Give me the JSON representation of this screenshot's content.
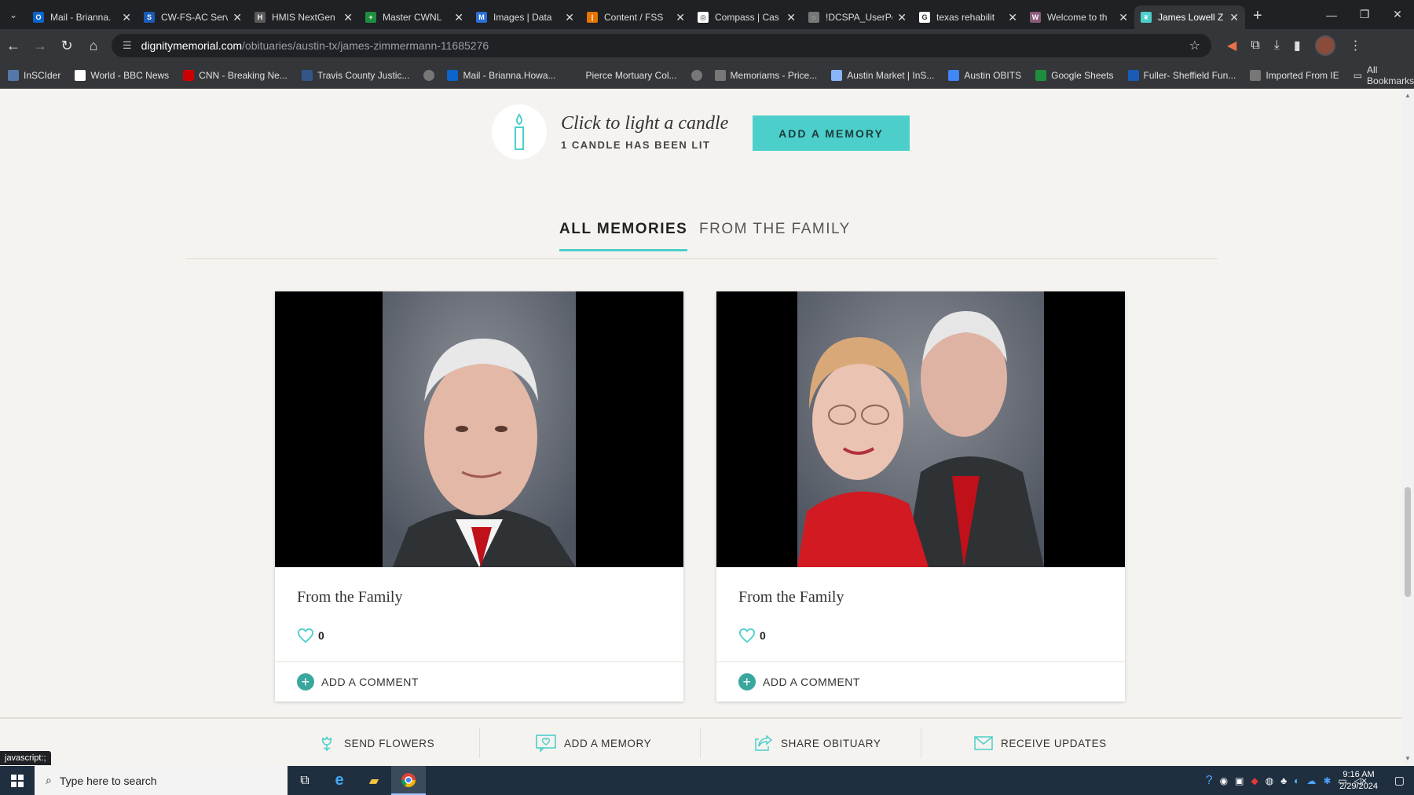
{
  "browser": {
    "tabs": [
      {
        "label": "Mail - Brianna.",
        "color": "#0a64c9",
        "glyph": "O"
      },
      {
        "label": "CW-FS-AC Serv",
        "color": "#1a5bb8",
        "glyph": "S"
      },
      {
        "label": "HMIS NextGen",
        "color": "#5a5a5a",
        "glyph": "H"
      },
      {
        "label": "Master CWNL",
        "color": "#1e8e3e",
        "glyph": "+"
      },
      {
        "label": "Images | Data",
        "color": "#2a6fd6",
        "glyph": "M"
      },
      {
        "label": "Content / FSS",
        "color": "#e37400",
        "glyph": "|"
      },
      {
        "label": "Compass | Cas",
        "color": "#ffffff",
        "glyph": "◎"
      },
      {
        "label": "!DCSPA_UserPo",
        "color": "#777777",
        "glyph": "◌"
      },
      {
        "label": "texas rehabilit",
        "color": "#ffffff",
        "glyph": "G"
      },
      {
        "label": "Welcome to th",
        "color": "#8a5a7a",
        "glyph": "W"
      },
      {
        "label": "James Lowell Z",
        "color": "#4ccfcb",
        "glyph": "❦",
        "active": true
      }
    ],
    "url_host": "dignitymemorial.com",
    "url_path": "/obituaries/austin-tx/james-zimmermann-11685276",
    "bookmarks": [
      {
        "label": "InSCIder",
        "color": "#5577aa"
      },
      {
        "label": "World - BBC News",
        "color": "#ffffff"
      },
      {
        "label": "CNN - Breaking Ne...",
        "color": "#cc0000"
      },
      {
        "label": "Travis County Justic...",
        "color": "#335588"
      },
      {
        "label": "",
        "color": "#777777"
      },
      {
        "label": "Mail - Brianna.Howa...",
        "color": "#0a64c9"
      },
      {
        "label": "Pierce Mortuary Col...",
        "color": "#35363a"
      },
      {
        "label": "",
        "color": "#777777"
      },
      {
        "label": "Memoriams - Price...",
        "color": "#777777"
      },
      {
        "label": "Austin Market | InS...",
        "color": "#8ab4f8"
      },
      {
        "label": "Austin OBITS",
        "color": "#4285f4"
      },
      {
        "label": "Google Sheets",
        "color": "#1e8e3e"
      },
      {
        "label": "Fuller- Sheffield Fun...",
        "color": "#1a5bb8"
      },
      {
        "label": "Imported From IE",
        "color": "#777777"
      }
    ],
    "all_bookmarks": "All Bookmarks"
  },
  "candle": {
    "title": "Click to light a candle",
    "count": "1 CANDLE HAS BEEN LIT"
  },
  "add_memory_button": "ADD A MEMORY",
  "memory_tabs": {
    "all": "ALL MEMORIES",
    "family": "FROM THE FAMILY"
  },
  "cards": [
    {
      "caption": "From the Family",
      "likes": "0",
      "comment": "ADD A COMMENT"
    },
    {
      "caption": "From the Family",
      "likes": "0",
      "comment": "ADD A COMMENT"
    }
  ],
  "actions": {
    "send_flowers": "SEND FLOWERS",
    "add_memory": "ADD A MEMORY",
    "share": "SHARE OBITUARY",
    "updates": "RECEIVE UPDATES"
  },
  "status_tip": "javascript:;",
  "taskbar": {
    "search_placeholder": "Type here to search",
    "time": "9:16 AM",
    "date": "2/29/2024"
  },
  "colors": {
    "accent": "#4ccfcb",
    "comment_plus": "#3aa79f",
    "page_bg": "#f5f3f0"
  }
}
